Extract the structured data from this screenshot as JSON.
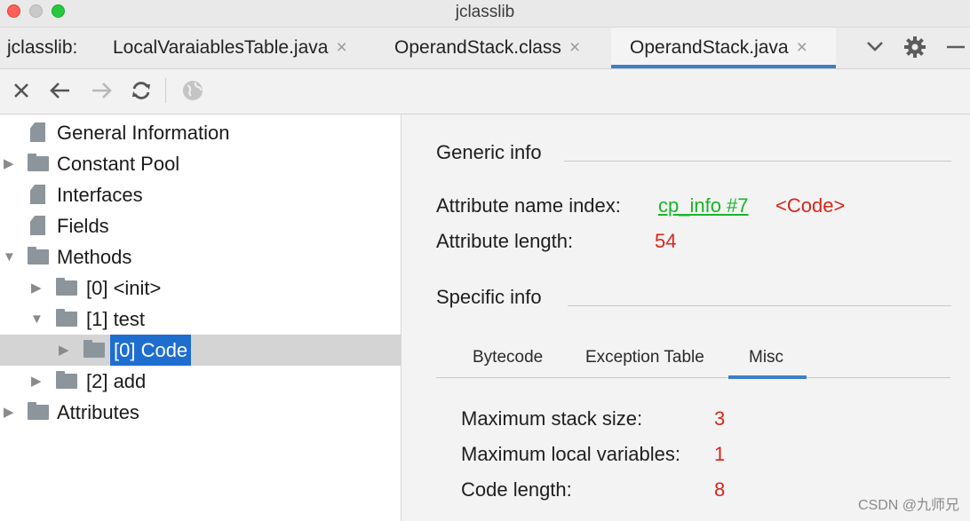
{
  "window": {
    "title": "jclasslib"
  },
  "tabs": {
    "prefix": "jclasslib:",
    "items": [
      {
        "label": "LocalVaraiablesTable.java",
        "active": false
      },
      {
        "label": "OperandStack.class",
        "active": false
      },
      {
        "label": "OperandStack.java",
        "active": true
      }
    ],
    "close_glyph": "×"
  },
  "toolbar": {
    "icons": [
      "close-icon",
      "back-icon",
      "forward-icon",
      "refresh-icon",
      "web-icon"
    ]
  },
  "tree": {
    "nodes": [
      {
        "label": "General Information",
        "icon": "file-icon"
      },
      {
        "label": "Constant Pool",
        "icon": "folder-icon"
      },
      {
        "label": "Interfaces",
        "icon": "file-icon"
      },
      {
        "label": "Fields",
        "icon": "file-icon"
      },
      {
        "label": "Methods",
        "icon": "folder-icon"
      },
      {
        "label": "[0] <init>",
        "icon": "folder-icon"
      },
      {
        "label": "[1] test",
        "icon": "folder-icon"
      },
      {
        "label": "[0] Code",
        "icon": "folder-icon",
        "selected": true
      },
      {
        "label": "[2] add",
        "icon": "folder-icon"
      },
      {
        "label": "Attributes",
        "icon": "folder-icon"
      }
    ]
  },
  "detail": {
    "generic_title": "Generic info",
    "attr_name_index_label": "Attribute name index:",
    "attr_name_index_link": "cp_info #7",
    "attr_name_index_value": "<Code>",
    "attr_length_label": "Attribute length:",
    "attr_length_value": "54",
    "specific_title": "Specific info",
    "subtabs": [
      "Bytecode",
      "Exception Table",
      "Misc"
    ],
    "active_subtab": "Misc",
    "max_stack_label": "Maximum stack size:",
    "max_stack_value": "3",
    "max_locals_label": "Maximum local variables:",
    "max_locals_value": "1",
    "code_length_label": "Code length:",
    "code_length_value": "8"
  },
  "watermark": "CSDN @九师兄",
  "colors": {
    "accent": "#3c7fc8",
    "selection": "#1d6ecf",
    "link": "#19b52a",
    "value": "#d8261a"
  }
}
